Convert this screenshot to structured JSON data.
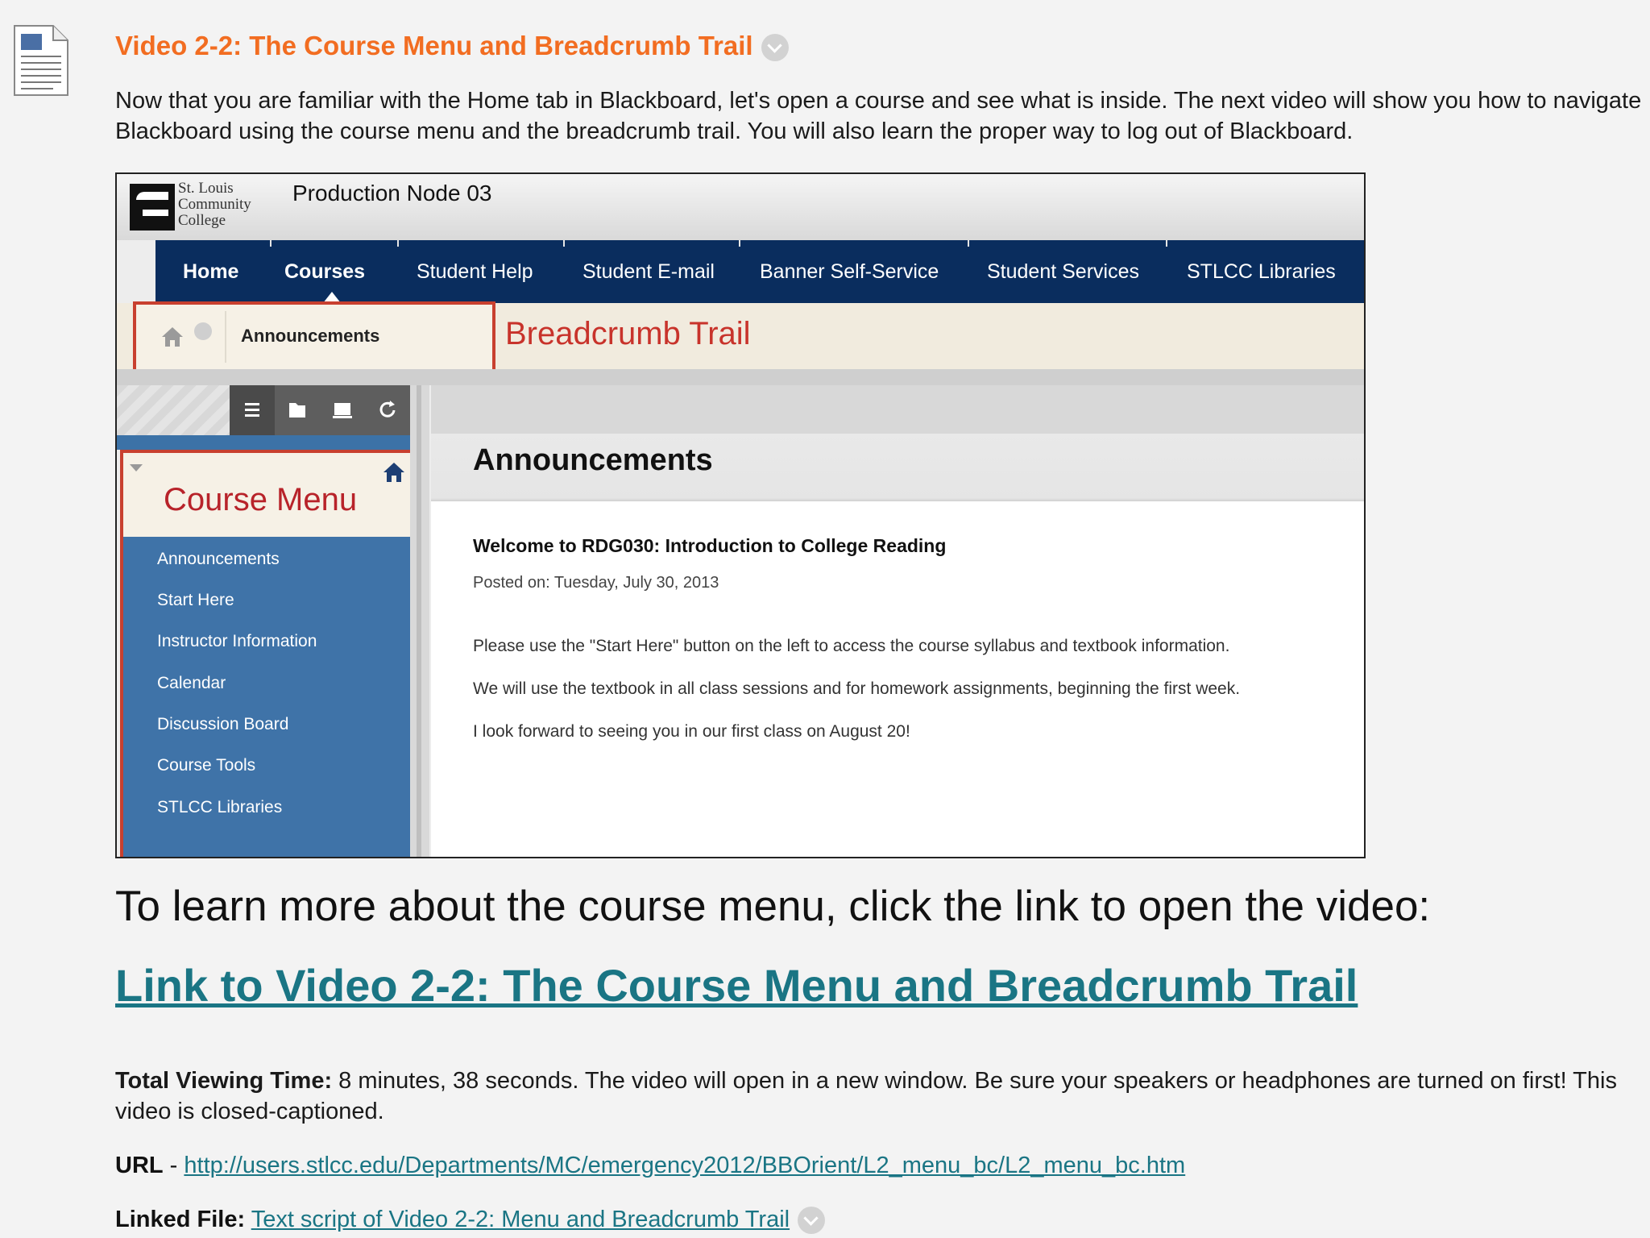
{
  "item": {
    "title": "Video 2-2: The Course Menu and Breadcrumb Trail",
    "intro": "Now that you are familiar with the Home tab in Blackboard, let's open a course and see what is inside. The next video will show you how to navigate Blackboard using the course menu and the breadcrumb trail. You will also learn the proper way to log out of Blackboard."
  },
  "screenshot": {
    "logo_lines": [
      "St. Louis",
      "Community",
      "College"
    ],
    "node_title": "Production Node 03",
    "tabs": [
      "Home",
      "Courses",
      "Student Help",
      "Student E-mail",
      "Banner Self-Service",
      "Student Services",
      "STLCC Libraries"
    ],
    "breadcrumb": "Announcements",
    "breadcrumb_annotation": "Breadcrumb Trail",
    "course_menu_annotation": "Course Menu",
    "menu_items": [
      "Announcements",
      "Start Here",
      "Instructor Information",
      "Calendar",
      "Discussion Board",
      "Course Tools",
      "STLCC Libraries"
    ],
    "content_title": "Announcements",
    "welcome": "Welcome to RDG030: Introduction to College Reading",
    "posted": "Posted on: Tuesday, July 30, 2013",
    "paragraphs": [
      "Please use the \"Start Here\" button on the left to access the course syllabus and textbook information.",
      "We will use the textbook in all class sessions and for homework assignments, beginning the first week.",
      "I look forward to seeing you in our first class on August 20!"
    ]
  },
  "learn_more": "To learn more about the course menu, click the link to open the video:",
  "video_link": "Link to Video 2-2: The Course Menu and Breadcrumb Trail",
  "viewing": {
    "label": "Total Viewing Time:",
    "text": " 8 minutes, 38 seconds. The video will open in a new window. Be sure your speakers or headphones are turned on first! This video is closed-captioned."
  },
  "url": {
    "label": "URL",
    "separator": " - ",
    "link": "http://users.stlcc.edu/Departments/MC/emergency2012/BBOrient/L2_menu_bc/L2_menu_bc.htm"
  },
  "linked_file": {
    "label": "Linked File:",
    "link": "Text script of Video 2-2: Menu and Breadcrumb Trail"
  },
  "colors": {
    "title_orange": "#f26d21",
    "link_teal": "#1a7584",
    "nav_navy": "#0a2d5e",
    "annotation_red": "#c8402f"
  }
}
